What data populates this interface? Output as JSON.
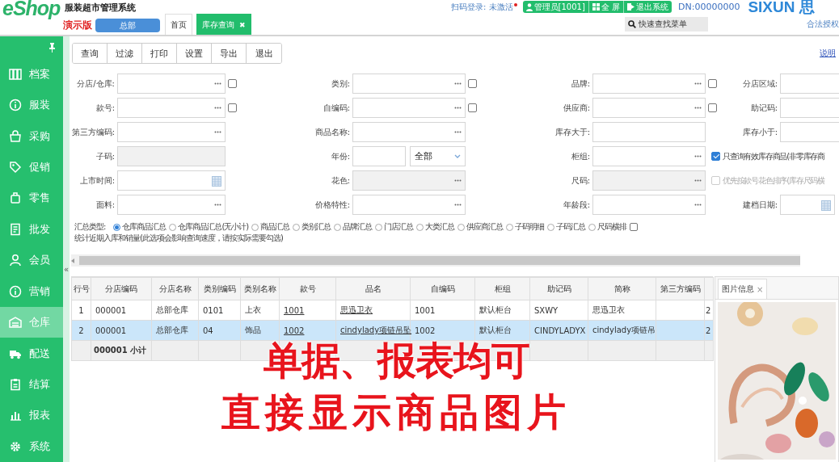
{
  "header": {
    "logo": "eShop",
    "title": "服装超市管理系统",
    "edition": "演示版",
    "branch_button": "总部",
    "tabs": [
      {
        "label": "首页",
        "selected": false
      },
      {
        "label": "库存查询",
        "selected": true,
        "close_glyph": "✖"
      }
    ],
    "scan_login": "扫码登录: 未激活",
    "user_buttons": [
      "管理员[1001]",
      "全 屏",
      "退出系统"
    ],
    "dn": "DN:00000000",
    "brand": "SIXUN 思",
    "search": {
      "placeholder": "快速查找菜单"
    },
    "license": "合法授权"
  },
  "sidebar": {
    "items": [
      {
        "label": "档案",
        "selected": false
      },
      {
        "label": "服装",
        "selected": false
      },
      {
        "label": "采购",
        "selected": false
      },
      {
        "label": "促销",
        "selected": false
      },
      {
        "label": "零售",
        "selected": false
      },
      {
        "label": "批发",
        "selected": false
      },
      {
        "label": "会员",
        "selected": false
      },
      {
        "label": "营销",
        "selected": false
      },
      {
        "label": "仓库",
        "selected": true
      },
      {
        "label": "配送",
        "selected": false
      },
      {
        "label": "结算",
        "selected": false
      },
      {
        "label": "报表",
        "selected": false
      },
      {
        "label": "系统",
        "selected": false
      }
    ],
    "collapse_glyph": "«"
  },
  "toolbar": {
    "buttons": [
      "查询",
      "过滤",
      "打印",
      "设置",
      "导出",
      "退出"
    ],
    "help_link": "说明"
  },
  "form": {
    "rows": [
      [
        {
          "label": "分店/仓库:",
          "kind": "lookup",
          "checkbox": false
        },
        {
          "label": "类别:",
          "kind": "lookup",
          "checkbox": false
        },
        {
          "label": "品牌:",
          "kind": "lookup",
          "checkbox": false
        },
        {
          "label": "分店区域:",
          "kind": "text"
        }
      ],
      [
        {
          "label": "款号:",
          "kind": "lookup",
          "checkbox": false
        },
        {
          "label": "自编码:",
          "kind": "lookup",
          "checkbox": false
        },
        {
          "label": "供应商:",
          "kind": "lookup",
          "checkbox": false
        },
        {
          "label": "助记码:",
          "kind": "text"
        }
      ],
      [
        {
          "label": "第三方编码:",
          "kind": "lookup"
        },
        {
          "label": "商品名称:",
          "kind": "lookup"
        },
        {
          "label": "库存大于:",
          "kind": "text"
        },
        {
          "label": "库存小于:",
          "kind": "text"
        }
      ],
      [
        {
          "label": "子码:",
          "kind": "text",
          "disabled": true
        },
        {
          "label": "年份:",
          "kind": "year",
          "select_value": "全部"
        },
        {
          "label": "柜组:",
          "kind": "lookup"
        },
        {
          "label": "只查询有效库存商品(非零库存商",
          "kind": "option",
          "checked": true,
          "disabled": false
        }
      ],
      [
        {
          "label": "上市时间:",
          "kind": "date"
        },
        {
          "label": "花色:",
          "kind": "lookup",
          "disabled": true
        },
        {
          "label": "尺码:",
          "kind": "lookup",
          "disabled": true
        },
        {
          "label": "优先按款号花色排序(库存尺码横",
          "kind": "option",
          "checked": false,
          "disabled": true
        }
      ],
      [
        {
          "label": "面料:",
          "kind": "lookup"
        },
        {
          "label": "价格特性:",
          "kind": "lookup"
        },
        {
          "label": "年龄段:",
          "kind": "lookup"
        },
        {
          "label": "建档日期:",
          "kind": "date"
        }
      ]
    ]
  },
  "summary": {
    "label": "汇总类型:",
    "options": [
      {
        "label": "仓库商品汇总",
        "selected": true
      },
      {
        "label": "仓库商品汇总(无小计)",
        "selected": false
      },
      {
        "label": "商品汇总",
        "selected": false
      },
      {
        "label": "类别汇总",
        "selected": false
      },
      {
        "label": "品牌汇总",
        "selected": false
      },
      {
        "label": "门店汇总",
        "selected": false
      },
      {
        "label": "大类汇总",
        "selected": false
      },
      {
        "label": "供应商汇总",
        "selected": false
      },
      {
        "label": "子码明细",
        "selected": false
      },
      {
        "label": "子码汇总",
        "selected": false
      },
      {
        "label": "尺码横排",
        "selected": false
      }
    ],
    "extra_option": {
      "label": "统计近期入库和销量(此选项会影响查询速度，请按实际需要勾选)",
      "checked": false
    }
  },
  "table": {
    "columns": [
      {
        "label": "行号",
        "link": false
      },
      {
        "label": "分店编码",
        "link": false
      },
      {
        "label": "分店名称",
        "link": false
      },
      {
        "label": "类别编码",
        "link": false
      },
      {
        "label": "类别名称",
        "link": false
      },
      {
        "label": "款号",
        "link": true
      },
      {
        "label": "品名",
        "link": true
      },
      {
        "label": "自编码",
        "link": false
      },
      {
        "label": "柜组",
        "link": false
      },
      {
        "label": "助记码",
        "link": false
      },
      {
        "label": "简称",
        "link": false
      },
      {
        "label": "第三方编码"
      },
      {
        "link": false
      }
    ],
    "rows": [
      {
        "kind": "data",
        "selected": false,
        "cells": [
          "1",
          "000001",
          "总部仓库",
          "0101",
          "上衣",
          "1001",
          "思迅卫衣",
          "1001",
          "默认柜台",
          "SXWY",
          "思迅卫衣",
          null,
          "2"
        ]
      },
      {
        "kind": "data",
        "selected": true,
        "cells": [
          "2",
          "000001",
          "总部仓库",
          "04",
          "饰品",
          "1002",
          "cindylady项链吊坠",
          "1002",
          "默认柜台",
          "CINDYLADYX",
          "cindylady项链吊",
          null,
          "2"
        ]
      },
      {
        "kind": "subtotal",
        "label": "000001 小计"
      }
    ]
  },
  "image_panel": {
    "tab": "图片信息",
    "close_glyph": "×"
  },
  "caption": {
    "lines": [
      "单据、报表均可",
      "直接显示商品图片"
    ]
  }
}
